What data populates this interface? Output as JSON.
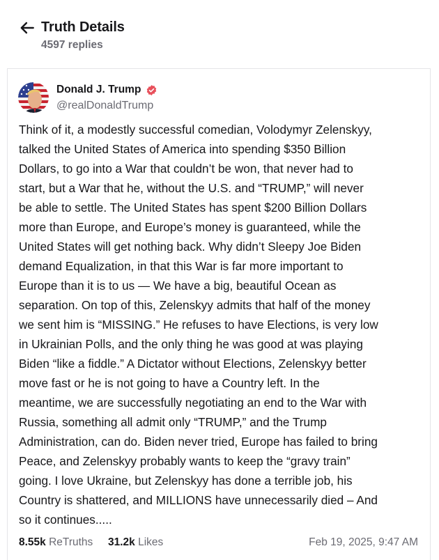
{
  "header": {
    "title": "Truth Details",
    "replies": "4597 replies"
  },
  "post": {
    "author_name": "Donald J. Trump",
    "author_handle": "@realDonaldTrump",
    "text": "Think of it, a modestly successful comedian, Volodymyr Zelenskyy,\ntalked the United States of America into spending $350 Billion\nDollars, to go into a War that couldn’t be won, that never had to\nstart, but a War that he, without the U.S. and “TRUMP,” will never\nbe able to settle. The United States has spent $200 Billion Dollars\nmore than Europe, and Europe’s money is guaranteed, while the\nUnited States will get nothing back. Why didn’t Sleepy Joe Biden\ndemand Equalization, in that this War is far more important to\nEurope than it is to us — We have a big, beautiful Ocean as\nseparation. On top of this, Zelenskyy admits that half of the money\nwe sent him is “MISSING.” He refuses to have Elections, is very low\nin Ukrainian Polls, and the only thing he was good at was playing\nBiden “like a fiddle.” A Dictator without Elections, Zelenskyy better\nmove fast or he is not going to have a Country left. In the\nmeantime, we are successfully negotiating an end to the War with\nRussia, something all admit only “TRUMP,” and the Trump\nAdministration, can do. Biden never tried, Europe has failed to bring\nPeace, and Zelenskyy probably wants to keep the “gravy train”\ngoing. I love Ukraine, but Zelenskyy has done a terrible job, his\nCountry is shattered, and MILLIONS have unnecessarily died – And\nso it continues.....",
    "retruths_count": "8.55k",
    "retruths_label": "ReTruths",
    "likes_count": "31.2k",
    "likes_label": "Likes",
    "timestamp": "Feb 19, 2025, 9:47 AM"
  },
  "icons": {
    "back": "arrow-left-icon",
    "verified": "verified-badge-icon"
  },
  "colors": {
    "text_primary": "#17171a",
    "text_secondary": "#6b6b73",
    "verified_badge": "#e8505b",
    "card_border": "#e4e4e8"
  }
}
